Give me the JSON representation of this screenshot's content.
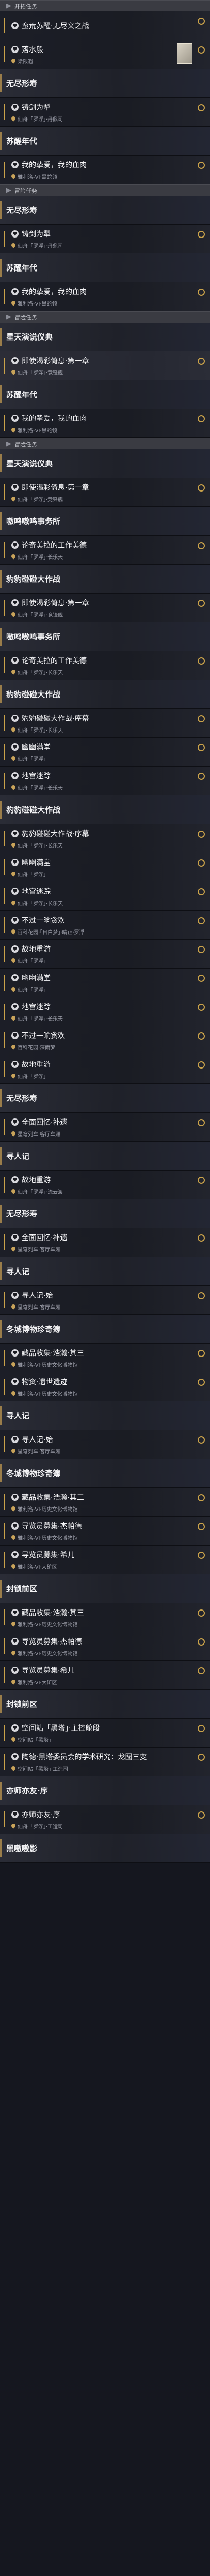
{
  "rows": [
    {
      "kind": "header",
      "label": "开拓任务"
    },
    {
      "kind": "card",
      "title": "蛮荒苏醒·无尽义之战",
      "loc": "",
      "active": false
    },
    {
      "kind": "card",
      "title": "落水般",
      "loc": "梁限遐",
      "bookmark": true
    },
    {
      "kind": "group",
      "title": "无尽形寿"
    },
    {
      "kind": "card",
      "title": "铸剑为犁",
      "loc": "仙舟「罗浮」·丹鼎司"
    },
    {
      "kind": "group",
      "title": "苏醒年代"
    },
    {
      "kind": "card",
      "title": "我的挚爱，我的血肉",
      "loc": "雅利洛-VI·黑蛇领"
    },
    {
      "kind": "header",
      "label": "冒险任务"
    },
    {
      "kind": "group",
      "title": "无尽形寿"
    },
    {
      "kind": "card",
      "title": "铸剑为犁",
      "loc": "仙舟「罗浮」·丹鼎司"
    },
    {
      "kind": "group",
      "title": "苏醒年代"
    },
    {
      "kind": "card",
      "title": "我的挚爱，我的血肉",
      "loc": "雅利洛-VI·黑蛇领"
    },
    {
      "kind": "header",
      "label": "冒险任务"
    },
    {
      "kind": "group",
      "title": "星天演说仪典"
    },
    {
      "kind": "card",
      "title": "即使渴彩倚息·第一章",
      "loc": "仙舟「罗浮」·竞锋舰",
      "active": true
    },
    {
      "kind": "group",
      "title": "苏醒年代"
    },
    {
      "kind": "card",
      "title": "我的挚爱，我的血肉",
      "loc": "雅利洛-VI·黑蛇领"
    },
    {
      "kind": "header",
      "label": "冒险任务"
    },
    {
      "kind": "group",
      "title": "星天演说仪典"
    },
    {
      "kind": "card",
      "title": "即使渴彩倚息·第一章",
      "loc": "仙舟「罗浮」·竞锋舰"
    },
    {
      "kind": "group",
      "title": "嗷鸣嗷鸣事务所"
    },
    {
      "kind": "card",
      "title": "论奇美拉的工作美德",
      "loc": "仙舟「罗浮」·长乐天"
    },
    {
      "kind": "group",
      "title": "豹豹碰碰大作战"
    },
    {
      "kind": "card",
      "title": "即使渴彩倚息·第一章",
      "loc": "仙舟「罗浮」·竞锋舰"
    },
    {
      "kind": "group",
      "title": "嗷鸣嗷鸣事务所"
    },
    {
      "kind": "card",
      "title": "论奇美拉的工作美德",
      "loc": "仙舟「罗浮」·长乐天"
    },
    {
      "kind": "group",
      "title": "豹豹碰碰大作战"
    },
    {
      "kind": "card",
      "title": "豹豹碰碰大作战·序幕",
      "loc": "仙舟「罗浮」·长乐天"
    },
    {
      "kind": "card",
      "title": "幽幽满堂",
      "loc": "仙舟「罗浮」"
    },
    {
      "kind": "card",
      "title": "地宫迷踪",
      "loc": "仙舟「罗浮」·长乐天"
    },
    {
      "kind": "group",
      "title": "豹豹碰碰大作战"
    },
    {
      "kind": "card",
      "title": "豹豹碰碰大作战·序幕",
      "loc": "仙舟「罗浮」·长乐天"
    },
    {
      "kind": "card",
      "title": "幽幽满堂",
      "loc": "仙舟「罗浮」"
    },
    {
      "kind": "card",
      "title": "地宫迷踪",
      "loc": "仙舟「罗浮」·长乐天"
    },
    {
      "kind": "card",
      "title": "不过一晌贪欢",
      "loc": "百科花园·「日白梦」·晴正·罗浮"
    },
    {
      "kind": "card",
      "title": "故地重游",
      "loc": "仙舟「罗浮」"
    },
    {
      "kind": "card",
      "title": "幽幽满堂",
      "loc": "仙舟「罗浮」"
    },
    {
      "kind": "card",
      "title": "地宫迷踪",
      "loc": "仙舟「罗浮」·长乐天"
    },
    {
      "kind": "card",
      "title": "不过一晌贪欢",
      "loc": "百科花园·深雨梦"
    },
    {
      "kind": "card",
      "title": "故地重游",
      "loc": "仙舟「罗浮」"
    },
    {
      "kind": "group",
      "title": "无尽形寿"
    },
    {
      "kind": "card",
      "title": "全面回忆·补遗",
      "loc": "星穹列车·客厅车厢"
    },
    {
      "kind": "group",
      "title": "寻人记"
    },
    {
      "kind": "card",
      "title": "故地重游",
      "loc": "仙舟「罗浮」·流云渡"
    },
    {
      "kind": "group",
      "title": "无尽形寿"
    },
    {
      "kind": "card",
      "title": "全面回忆·补遗",
      "loc": "星穹列车·客厅车厢"
    },
    {
      "kind": "group",
      "title": "寻人记"
    },
    {
      "kind": "card",
      "title": "寻人记·始",
      "loc": "星穹列车·客厅车厢"
    },
    {
      "kind": "group",
      "title": "冬城博物珍奇簿"
    },
    {
      "kind": "card",
      "title": "藏品收集·浩瀚·其三",
      "loc": "雅利洛-VI·历史文化博物馆"
    },
    {
      "kind": "card",
      "title": "物资·遗世遗迹",
      "loc": "雅利洛-VI·历史文化博物馆"
    },
    {
      "kind": "group",
      "title": "寻人记"
    },
    {
      "kind": "card",
      "title": "寻人记·始",
      "loc": "星穹列车·客厅车厢"
    },
    {
      "kind": "group",
      "title": "冬城博物珍奇簿"
    },
    {
      "kind": "card",
      "title": "藏品收集·浩瀚·其三",
      "loc": "雅利洛-VI·历史文化博物馆"
    },
    {
      "kind": "card",
      "title": "导览员募集·杰帕德",
      "loc": "雅利洛-VI·历史文化博物馆"
    },
    {
      "kind": "card",
      "title": "导览员募集·希儿",
      "loc": "雅利洛-VI·大矿区"
    },
    {
      "kind": "group",
      "title": "封锁前区"
    },
    {
      "kind": "card",
      "title": "藏品收集·浩瀚·其三",
      "loc": "雅利洛-VI·历史文化博物馆"
    },
    {
      "kind": "card",
      "title": "导览员募集·杰帕德",
      "loc": "雅利洛-VI·历史文化博物馆"
    },
    {
      "kind": "card",
      "title": "导览员募集·希儿",
      "loc": "雅利洛-VI·大矿区"
    },
    {
      "kind": "group",
      "title": "封锁前区"
    },
    {
      "kind": "card",
      "title": "空间站「黑塔」·主控舱段",
      "loc": "空间站「黑塔」"
    },
    {
      "kind": "card",
      "title": "陶德·黑塔委员会的学术研究：龙图三变",
      "loc": "空间站「黑塔」·工造司"
    },
    {
      "kind": "group",
      "title": "亦师亦友·序"
    },
    {
      "kind": "card",
      "title": "亦师亦友·序",
      "loc": "仙舟「罗浮」·工造司"
    },
    {
      "kind": "group",
      "title": "黑嗷嗷影"
    }
  ]
}
